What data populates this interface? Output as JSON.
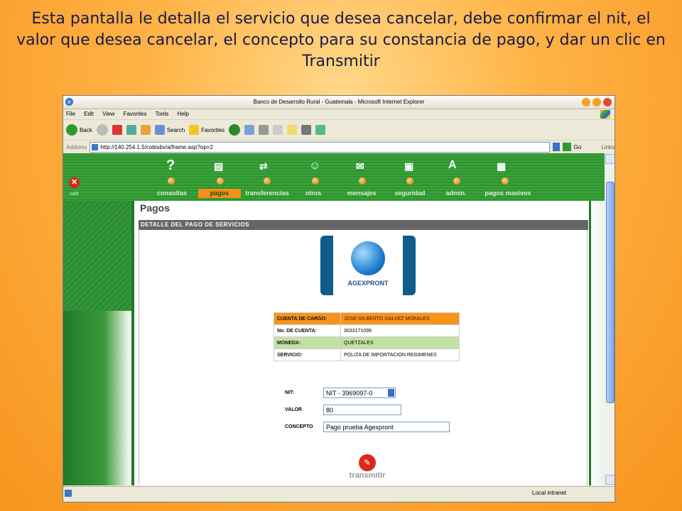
{
  "caption": "Esta pantalla le detalla el servicio que desea cancelar, debe confirmar el nit, el valor que desea cancelar, el concepto para su constancia de pago, y dar un clic en Transmitir",
  "browser": {
    "title": "Banco de Desarrollo Rural - Guatemala - Microsoft Internet Explorer",
    "menu": [
      "File",
      "Edit",
      "View",
      "Favorites",
      "Tools",
      "Help"
    ],
    "toolbar": {
      "back": "Back",
      "search": "Search",
      "favorites": "Favorites"
    },
    "address_label": "Address",
    "url": "http://140.254.1.5/cobisbv/a/frame.asp?op=2",
    "go": "Go",
    "links": "Links",
    "status_zone": "Local intranet"
  },
  "site": {
    "salir": "salir",
    "nav": [
      "consultas",
      "pagos",
      "transferencias",
      "otros",
      "mensajes",
      "seguridad",
      "admin.",
      "pagos masivos"
    ],
    "active_nav": "pagos"
  },
  "page": {
    "title": "Pagos",
    "section": "DETALLE DEL PAGO DE SERVICIOS",
    "logo_text": "AGEXPRONT",
    "details": [
      {
        "label": "CUENTA DE CARGO:",
        "value": "JOSE GILBERTO GALVEZ MORALES"
      },
      {
        "label": "No. DE CUENTA:",
        "value": "3033171099"
      },
      {
        "label": "MONEDA:",
        "value": "QUETZALES"
      },
      {
        "label": "SERVICIO:",
        "value": "POLIZA DE IMPORTACION REGIMENES"
      }
    ],
    "form": {
      "nit_label": "NIT:",
      "nit_value": "NIT - 3969097-0",
      "valor_label": "VALOR",
      "valor_value": "80",
      "concepto_label": "CONCEPTO",
      "concepto_value": "Pago prueba Agexpront"
    },
    "transmit_label": "transmitir"
  },
  "colors": {
    "accent": "#f7941d",
    "green": "#2f9430",
    "row_green": "#c4e1a4"
  }
}
